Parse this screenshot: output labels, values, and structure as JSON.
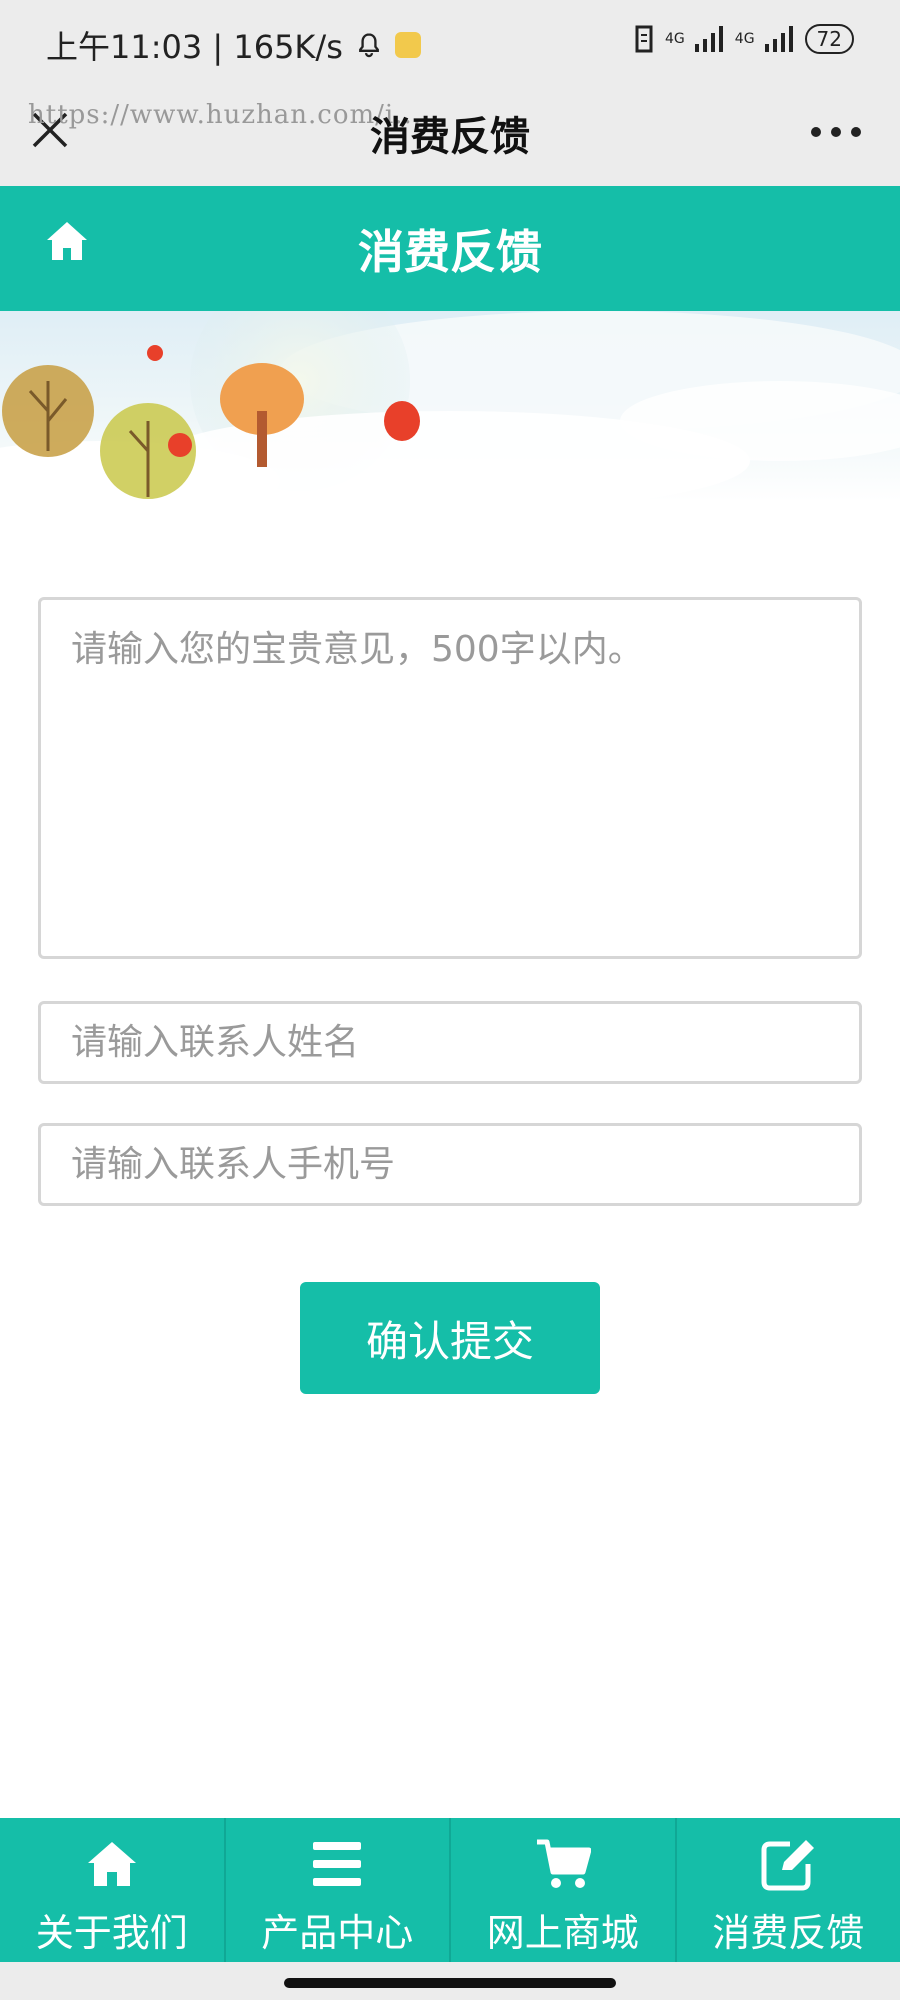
{
  "status_bar": {
    "time_speed": "上午11:03 | 165K/s",
    "network_1": "4G",
    "network_2": "4G",
    "battery": "72"
  },
  "webview": {
    "title": "消费反馈",
    "url": "https://www.huzhan.com/i..."
  },
  "header": {
    "title": "消费反馈"
  },
  "form": {
    "feedback_placeholder": "请输入您的宝贵意见，500字以内。",
    "name_placeholder": "请输入联系人姓名",
    "phone_placeholder": "请输入联系人手机号",
    "submit_label": "确认提交"
  },
  "bottom_nav": {
    "items": [
      {
        "label": "关于我们",
        "icon": "home-icon"
      },
      {
        "label": "产品中心",
        "icon": "list-icon"
      },
      {
        "label": "网上商城",
        "icon": "cart-icon"
      },
      {
        "label": "消费反馈",
        "icon": "edit-icon"
      }
    ]
  },
  "colors": {
    "accent": "#15bea8",
    "chrome": "#ececec"
  }
}
